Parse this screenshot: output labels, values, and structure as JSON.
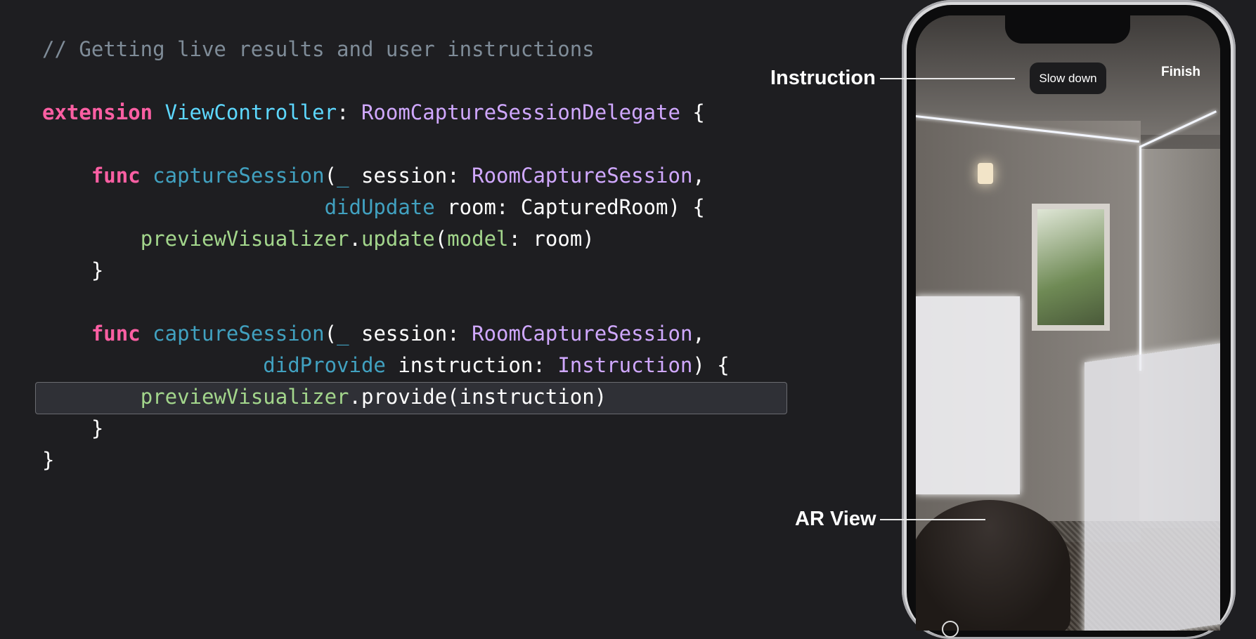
{
  "code": {
    "lines": [
      [
        {
          "t": "// Getting live results and user instructions",
          "c": "comment"
        }
      ],
      [],
      [
        {
          "t": "extension",
          "c": "kw"
        },
        {
          "t": " ",
          "c": "plain"
        },
        {
          "t": "ViewController",
          "c": "type"
        },
        {
          "t": ": ",
          "c": "plain"
        },
        {
          "t": "RoomCaptureSessionDelegate",
          "c": "proto"
        },
        {
          "t": " {",
          "c": "plain"
        }
      ],
      [],
      [
        {
          "t": "    ",
          "c": "plain"
        },
        {
          "t": "func",
          "c": "kw"
        },
        {
          "t": " ",
          "c": "plain"
        },
        {
          "t": "captureSession",
          "c": "fn"
        },
        {
          "t": "(",
          "c": "plain"
        },
        {
          "t": "_",
          "c": "fn"
        },
        {
          "t": " session: ",
          "c": "plain"
        },
        {
          "t": "RoomCaptureSession",
          "c": "proto"
        },
        {
          "t": ",",
          "c": "plain"
        }
      ],
      [
        {
          "t": "                       ",
          "c": "plain"
        },
        {
          "t": "didUpdate",
          "c": "fn"
        },
        {
          "t": " room: CapturedRoom) {",
          "c": "plain"
        }
      ],
      [
        {
          "t": "        ",
          "c": "plain"
        },
        {
          "t": "previewVisualizer",
          "c": "call"
        },
        {
          "t": ".",
          "c": "plain"
        },
        {
          "t": "update",
          "c": "call"
        },
        {
          "t": "(",
          "c": "plain"
        },
        {
          "t": "model",
          "c": "call"
        },
        {
          "t": ": room)",
          "c": "plain"
        }
      ],
      [
        {
          "t": "    }",
          "c": "plain"
        }
      ],
      [],
      [
        {
          "t": "    ",
          "c": "plain"
        },
        {
          "t": "func",
          "c": "kw"
        },
        {
          "t": " ",
          "c": "plain"
        },
        {
          "t": "captureSession",
          "c": "fn"
        },
        {
          "t": "(",
          "c": "plain"
        },
        {
          "t": "_",
          "c": "fn"
        },
        {
          "t": " session: ",
          "c": "plain"
        },
        {
          "t": "RoomCaptureSession",
          "c": "proto"
        },
        {
          "t": ",",
          "c": "plain"
        }
      ],
      [
        {
          "t": "                  ",
          "c": "plain"
        },
        {
          "t": "didProvide",
          "c": "fn"
        },
        {
          "t": " instruction: ",
          "c": "plain"
        },
        {
          "t": "Instruction",
          "c": "proto"
        },
        {
          "t": ") {",
          "c": "plain"
        }
      ],
      [
        {
          "t": "        ",
          "c": "plain"
        },
        {
          "t": "previewVisualizer",
          "c": "call"
        },
        {
          "t": ".provide(instruction)",
          "c": "plain"
        }
      ],
      [
        {
          "t": "    }",
          "c": "plain"
        }
      ],
      [
        {
          "t": "}",
          "c": "plain"
        }
      ]
    ],
    "highlighted_line": 11
  },
  "phone": {
    "instruction_pill": "Slow down",
    "finish_button": "Finish"
  },
  "annotations": {
    "instruction_label": "Instruction",
    "ar_view_label": "AR View"
  },
  "colors": {
    "background": "#1e1e21",
    "keyword": "#fc5fa3",
    "type": "#5dd8ff",
    "protocol": "#d0a8ff",
    "function": "#41a1c0",
    "call": "#a3d68c",
    "comment": "#7f8c98"
  }
}
